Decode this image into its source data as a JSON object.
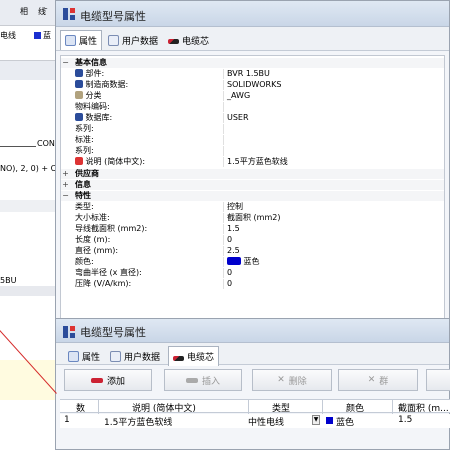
{
  "background_window": {
    "col_header_1": "相",
    "col_header_2": "线̄",
    "row_cell_1": "电线",
    "row_cell_2": "蓝",
    "frag_con": "CON",
    "frag_formula": "NO), 2, 0) + C",
    "frag_bu": "5BU"
  },
  "main_window": {
    "title": "电缆型号属性",
    "tabs": [
      {
        "label": "属性"
      },
      {
        "label": "用户数据"
      },
      {
        "label": "电缆芯"
      }
    ],
    "sections": {
      "basic": "基本信息",
      "supplier": "供应商",
      "info": "信息",
      "features": "特性"
    },
    "basic_rows": [
      {
        "key": "部件:",
        "value": "BVR 1.5BU"
      },
      {
        "key": "制造商数据:",
        "value": "SOLIDWORKS"
      },
      {
        "key": "分类",
        "value": "_AWG"
      },
      {
        "key": "物料编码:",
        "value": ""
      },
      {
        "key": "数据库:",
        "value": "USER"
      },
      {
        "key": "系列:",
        "value": ""
      },
      {
        "key": "标准:",
        "value": ""
      },
      {
        "key": "系列:",
        "value": ""
      },
      {
        "key": "说明 (简体中文):",
        "value": "1.5平方蓝色软线"
      }
    ],
    "feature_rows": [
      {
        "key": "类型:",
        "value": "控制"
      },
      {
        "key": "大小标准:",
        "value": "截面积 (mm2)"
      },
      {
        "key": "导线截面积 (mm2):",
        "value": "1.5"
      },
      {
        "key": "长度 (m):",
        "value": "0"
      },
      {
        "key": "直径 (mm):",
        "value": "2.5"
      },
      {
        "key": "颜色:",
        "value": "蓝色"
      },
      {
        "key": "弯曲半径 (x 直径):",
        "value": "0"
      },
      {
        "key": "压降 (V/A/km):",
        "value": "0"
      }
    ]
  },
  "core_window": {
    "title": "电缆型号属性",
    "tabs": [
      {
        "label": "属性"
      },
      {
        "label": "用户数据"
      },
      {
        "label": "电缆芯"
      }
    ],
    "toolbar": {
      "add": "添加",
      "insert": "插入",
      "delete": "删除",
      "x_label": "群"
    },
    "table": {
      "headers": [
        "数",
        "说明 (简体中文)",
        "类型",
        "颜色",
        "截面积 (m..."
      ],
      "rows": [
        {
          "num": "1",
          "desc": "1.5平方蓝色软线",
          "type": "中性电线",
          "color": "蓝色",
          "area": "1.5"
        }
      ]
    },
    "colors": {
      "blue": "#0000cc",
      "accent": "#d52a2a"
    }
  }
}
